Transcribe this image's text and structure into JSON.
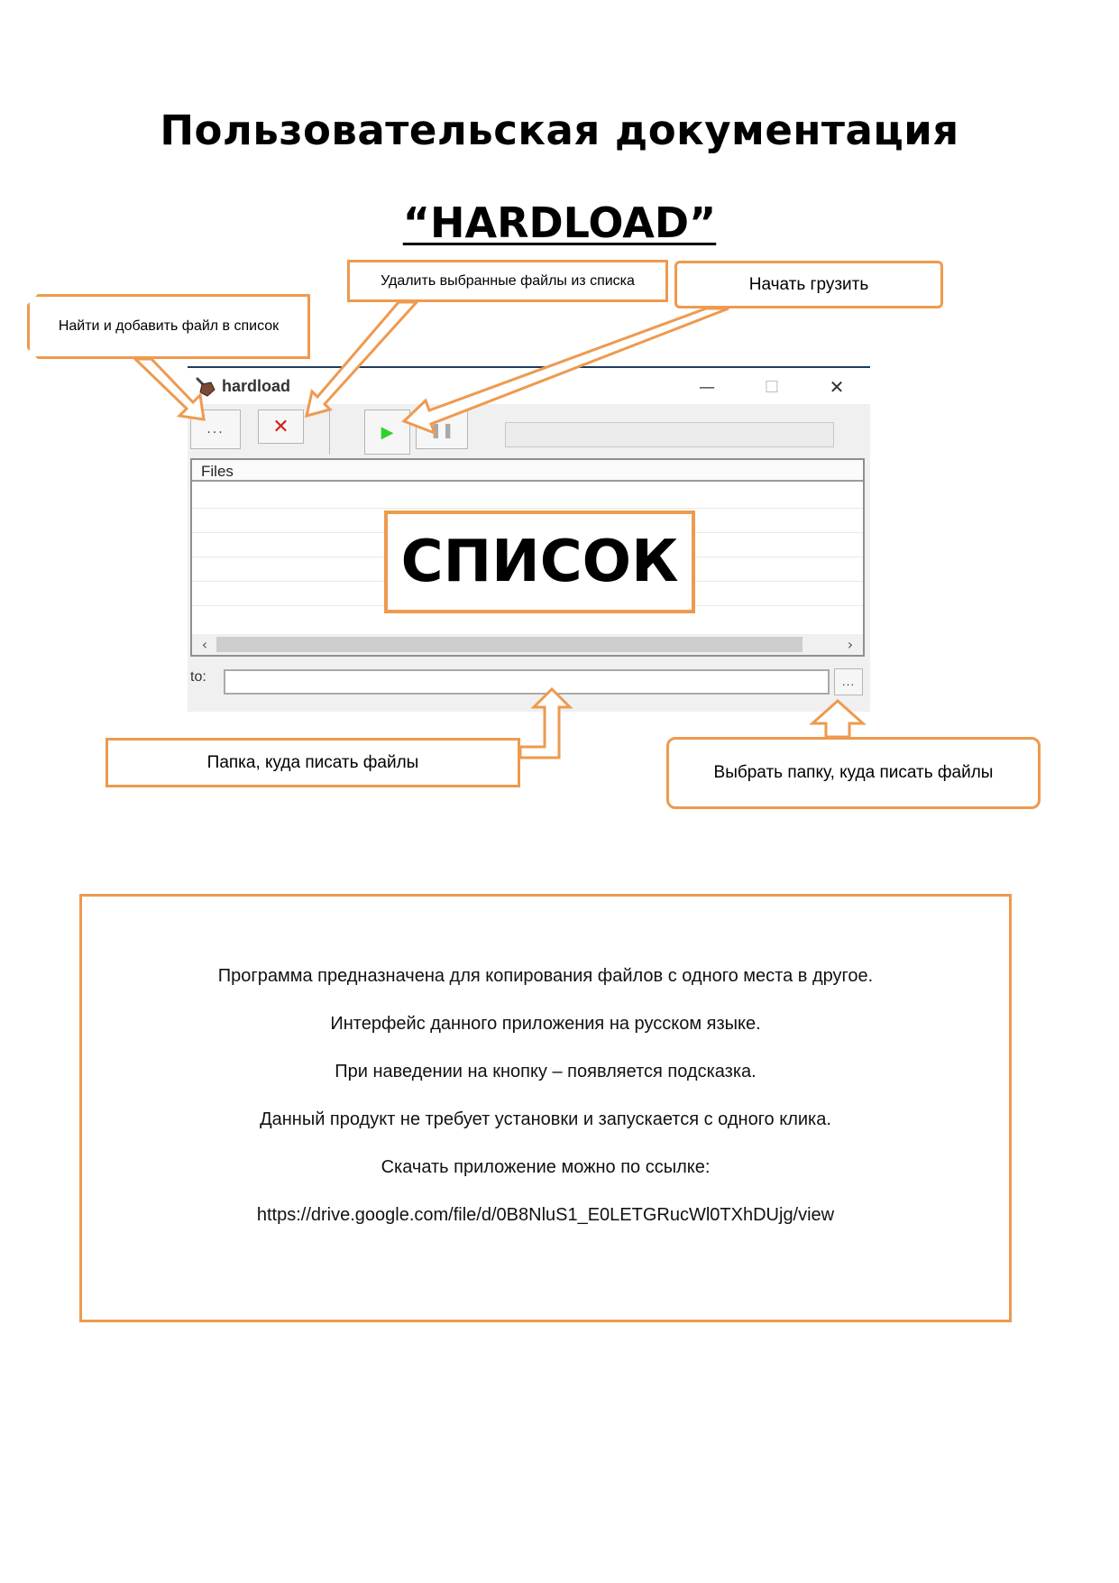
{
  "document": {
    "title": "Пользовательская документация",
    "subtitle": "“HARDLOAD”"
  },
  "callouts": {
    "add_file": "Найти и добавить файл в список",
    "remove_files": "Удалить выбранные файлы из списка",
    "start": "Начать грузить",
    "dest_folder": "Папка, куда писать файлы",
    "choose_folder": "Выбрать папку, куда писать файлы"
  },
  "window": {
    "title": "hardload",
    "minimize_glyph": "—",
    "maximize_glyph": "☐",
    "close_glyph": "✕",
    "toolbar": {
      "add_glyph": "...",
      "remove_glyph": "✕",
      "play_glyph": "▶",
      "pause_glyph": "❚❚"
    },
    "list": {
      "column_header": "Files",
      "overlay_label": "СПИСОК",
      "scroll_left": "‹",
      "scroll_right": "›"
    },
    "destination": {
      "label": "to:",
      "value": "",
      "browse_glyph": "..."
    }
  },
  "icons": {
    "app": "shovel-icon",
    "add": "ellipsis-icon",
    "remove": "red-x-icon",
    "play": "green-play-icon",
    "pause": "pause-icon"
  },
  "colors": {
    "accent": "#ee9a4f",
    "remove": "#d21f1f",
    "play": "#2fd12f"
  },
  "info": {
    "lines": [
      "Программа предназначена для копирования файлов с одного места в другое.",
      "Интерфейс данного приложения на русском языке.",
      "При наведении на кнопку – появляется подсказка.",
      "Данный продукт не требует установки и запускается с одного клика.",
      "Скачать приложение можно по ссылке:",
      "https://drive.google.com/file/d/0B8NluS1_E0LETGRucWl0TXhDUjg/view"
    ]
  }
}
